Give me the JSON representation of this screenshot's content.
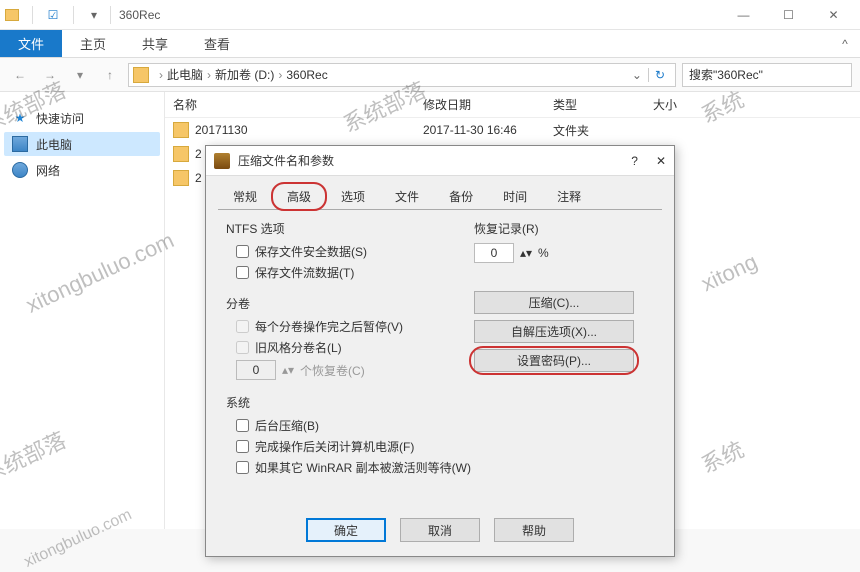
{
  "window": {
    "title": "360Rec",
    "min": "—",
    "max": "☐",
    "close": "✕"
  },
  "ribbon": {
    "file": "文件",
    "tabs": [
      "主页",
      "共享",
      "查看"
    ],
    "expand": "^"
  },
  "address": {
    "crumbs": [
      "此电脑",
      "新加卷 (D:)",
      "360Rec"
    ],
    "search_placeholder": "搜索\"360Rec\""
  },
  "nav": {
    "quick": "快速访问",
    "pc": "此电脑",
    "network": "网络"
  },
  "columns": {
    "name": "名称",
    "date": "修改日期",
    "type": "类型",
    "size": "大小"
  },
  "rows": [
    {
      "name": "20171130",
      "date": "2017-11-30 16:46",
      "type": "文件夹"
    },
    {
      "name": "2"
    },
    {
      "name": "2"
    }
  ],
  "dialog": {
    "title": "压缩文件名和参数",
    "help": "?",
    "close": "✕",
    "tabs": [
      "常规",
      "高级",
      "选项",
      "文件",
      "备份",
      "时间",
      "注释"
    ],
    "ntfs": {
      "label": "NTFS 选项",
      "save_security": "保存文件安全数据(S)",
      "save_streams": "保存文件流数据(T)"
    },
    "volumes": {
      "label": "分卷",
      "pause_after": "每个分卷操作完之后暂停(V)",
      "old_style": "旧风格分卷名(L)",
      "recover_count": "0",
      "recover_label": "个恢复卷(C)"
    },
    "recovery": {
      "label": "恢复记录(R)",
      "value": "0",
      "pct": "%"
    },
    "buttons": {
      "compress": "压缩(C)...",
      "sfx": "自解压选项(X)...",
      "password": "设置密码(P)..."
    },
    "system": {
      "label": "系统",
      "background": "后台压缩(B)",
      "shutdown": "完成操作后关闭计算机电源(F)",
      "wait_winrar": "如果其它 WinRAR 副本被激活则等待(W)"
    },
    "footer": {
      "ok": "确定",
      "cancel": "取消",
      "help": "帮助"
    }
  }
}
